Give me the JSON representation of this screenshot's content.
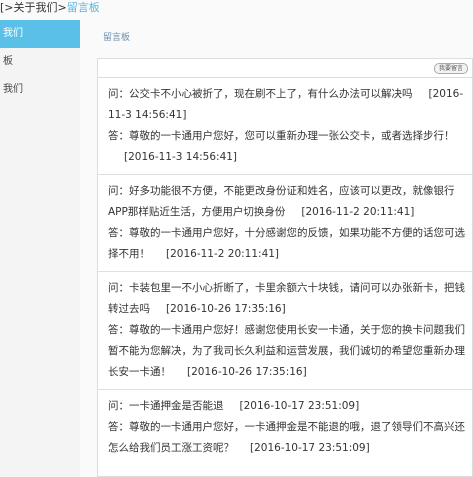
{
  "breadcrumb": {
    "part1": "[>关于我们>",
    "current": "留言板"
  },
  "sidebar": {
    "items": [
      {
        "label": "我们"
      },
      {
        "label": "板"
      },
      {
        "label": "我们"
      }
    ]
  },
  "panel": {
    "title": "留言板"
  },
  "toolbar": {
    "button_label": "我要留言"
  },
  "messages": [
    {
      "question": "问：公交卡不小心被折了，现在刷不上了，有什么办法可以解决吗",
      "question_time": "[2016-11-3 14:56:41]",
      "answer": "答：尊敬的一卡通用户您好，您可以重新办理一张公交卡，或者选择步行！",
      "answer_time": "[2016-11-3 14:56:41]"
    },
    {
      "question": "问：好多功能很不方便，不能更改身份证和姓名，应该可以更改，就像银行APP那样贴近生活，方便用户切换身份",
      "question_time": "[2016-11-2 20:11:41]",
      "answer": "答：尊敬的一卡通用户您好，十分感谢您的反馈，如果功能不方便的话您可选择不用！",
      "answer_time": "[2016-11-2 20:11:41]"
    },
    {
      "question": "问：卡装包里一不小心折断了，卡里余额六十块钱，请问可以办张新卡，把钱转过去吗",
      "question_time": "[2016-10-26 17:35:16]",
      "answer": "答：尊敬的一卡通用户您好！感谢您使用长安一卡通，关于您的换卡问题我们暂不能为您解决，为了我司长久利益和运营发展，我们诚切的希望您重新办理长安一卡通！",
      "answer_time": "[2016-10-26 17:35:16]"
    },
    {
      "question": "问：一卡通押金是否能退",
      "question_time": "[2016-10-17 23:51:09]",
      "answer": "答：尊敬的一卡通用户您好，一卡通押金是不能退的哦，退了领导们不高兴还怎么给我们员工涨工资呢？",
      "answer_time": "[2016-10-17 23:51:09]"
    }
  ]
}
